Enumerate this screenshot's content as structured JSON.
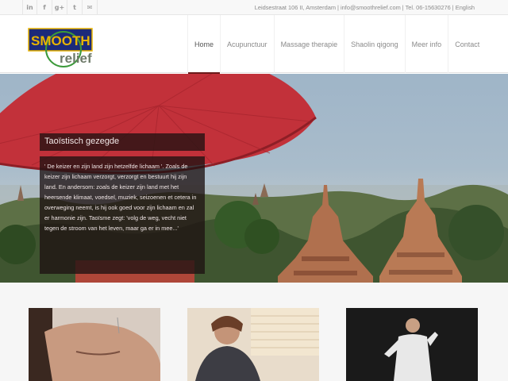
{
  "topbar": {
    "social": [
      {
        "icon": "linkedin-icon",
        "glyph": "in"
      },
      {
        "icon": "facebook-icon",
        "glyph": "f"
      },
      {
        "icon": "googleplus-icon",
        "glyph": "g+"
      },
      {
        "icon": "twitter-icon",
        "glyph": "t"
      },
      {
        "icon": "mail-icon",
        "glyph": "✉"
      }
    ],
    "contact": "Leidsestraat 106 II, Amsterdam | info@smoothrelief.com | Tel. 06-15630276 | English"
  },
  "logo": {
    "line1": "SMOOTH",
    "line2": "relief"
  },
  "nav": [
    {
      "label": "Home",
      "active": true
    },
    {
      "label": "Acupunctuur",
      "active": false
    },
    {
      "label": "Massage therapie",
      "active": false
    },
    {
      "label": "Shaolin qigong",
      "active": false
    },
    {
      "label": "Meer info",
      "active": false
    },
    {
      "label": "Contact",
      "active": false
    }
  ],
  "hero": {
    "title": "Taoïstisch gezegde",
    "quote": "' De keizer en zijn land zijn hetzelfde lichaam '. Zoals de keizer zijn lichaam verzorgt, verzorgt en bestuurt hij zijn land. En andersom: zoals de keizer zijn land met het heersende klimaat, voedsel, muziek, seizoenen et cetera in overweging neemt, is hij ook goed voor zijn lichaam en zal er harmonie zijn. Taoïsme zegt: 'volg de weg, vecht niet tegen de stroom van het leven, maar ga er in mee...'"
  },
  "colors": {
    "accent": "#6b1b1b",
    "umbrella": "#c2313a",
    "logo_blue": "#1c2a7a",
    "logo_gold": "#e8b400",
    "logo_green": "#3c9a3a"
  }
}
